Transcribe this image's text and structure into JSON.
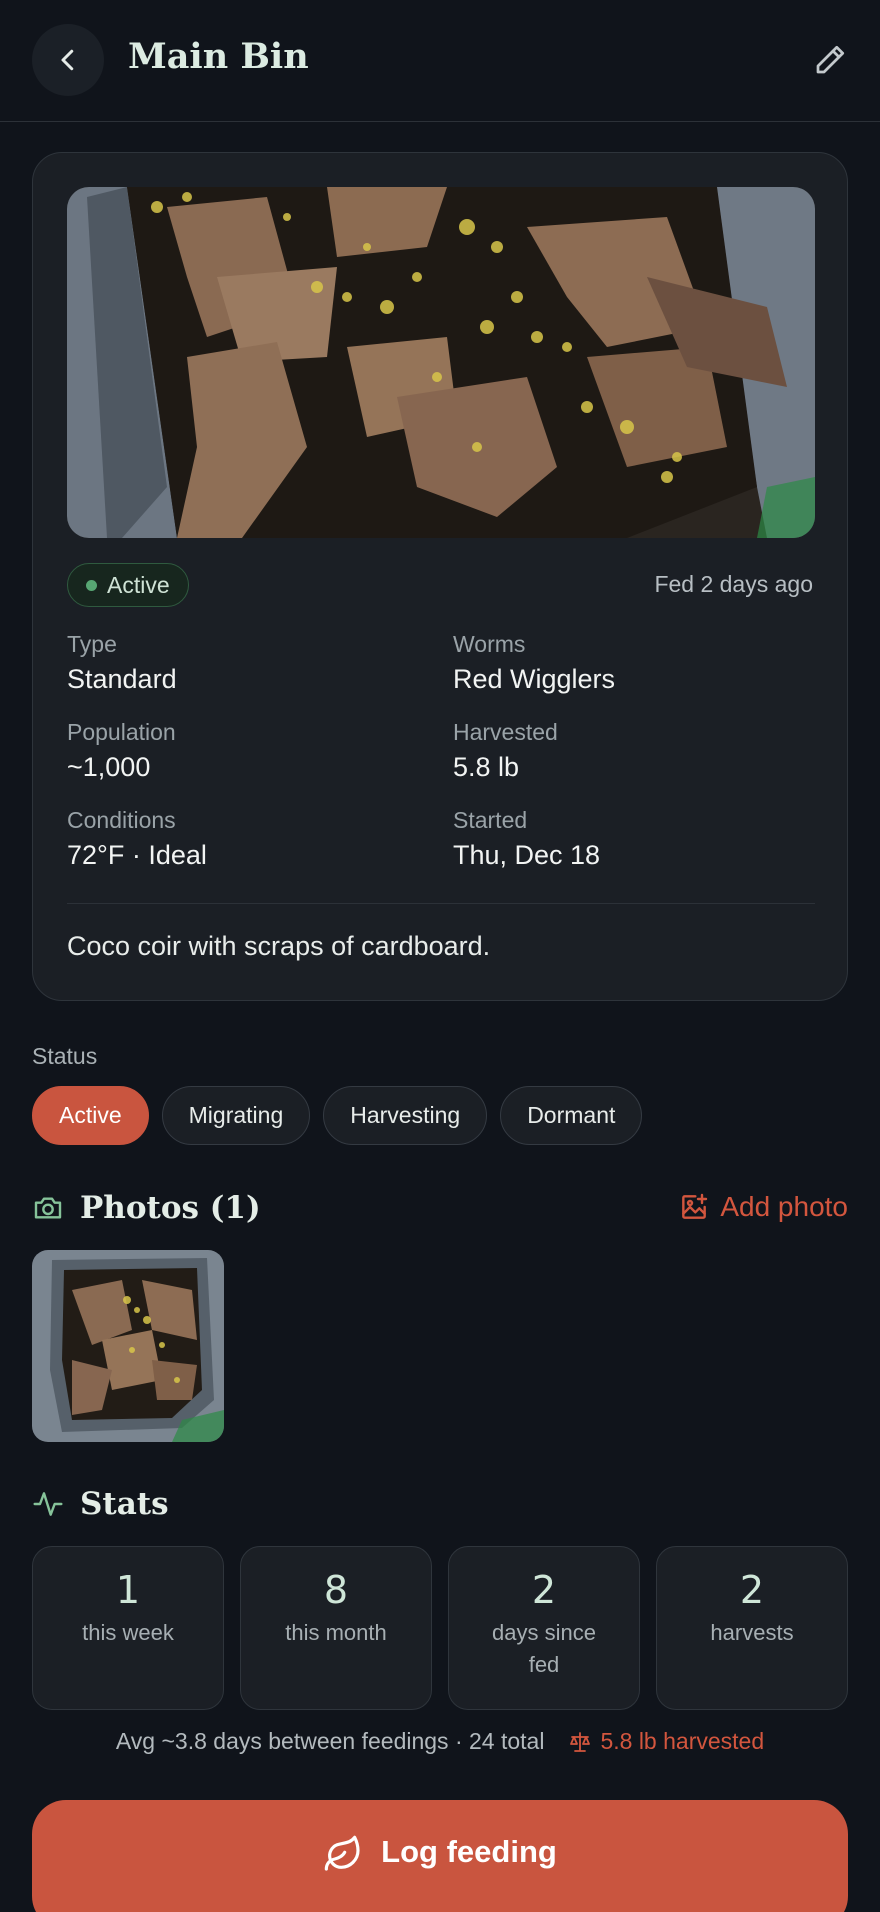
{
  "header": {
    "title": "Main Bin"
  },
  "bin": {
    "status_pill": "Active",
    "fed_text": "Fed 2 days ago",
    "info": {
      "type_label": "Type",
      "type_value": "Standard",
      "worms_label": "Worms",
      "worms_value": "Red Wigglers",
      "population_label": "Population",
      "population_value": "~1,000",
      "harvested_label": "Harvested",
      "harvested_value": "5.8 lb",
      "conditions_label": "Conditions",
      "conditions_value": "72°F · Ideal",
      "started_label": "Started",
      "started_value": "Thu, Dec 18"
    },
    "notes": "Coco coir with scraps of cardboard."
  },
  "status_section": {
    "label": "Status",
    "chips": [
      "Active",
      "Migrating",
      "Harvesting",
      "Dormant"
    ],
    "selected": "Active"
  },
  "photos": {
    "title": "Photos (1)",
    "add_label": "Add photo"
  },
  "stats": {
    "title": "Stats",
    "boxes": [
      {
        "value": "1",
        "label": "this week"
      },
      {
        "value": "8",
        "label": "this month"
      },
      {
        "value": "2",
        "label": "days since fed"
      },
      {
        "value": "2",
        "label": "harvests"
      }
    ],
    "summary": "Avg ~3.8 days between feedings · 24 total",
    "harvest_summary": "5.8 lb harvested"
  },
  "log_button": "Log feeding",
  "colors": {
    "accent": "#c9553f",
    "active_green": "#57a673",
    "background": "#10141b"
  }
}
